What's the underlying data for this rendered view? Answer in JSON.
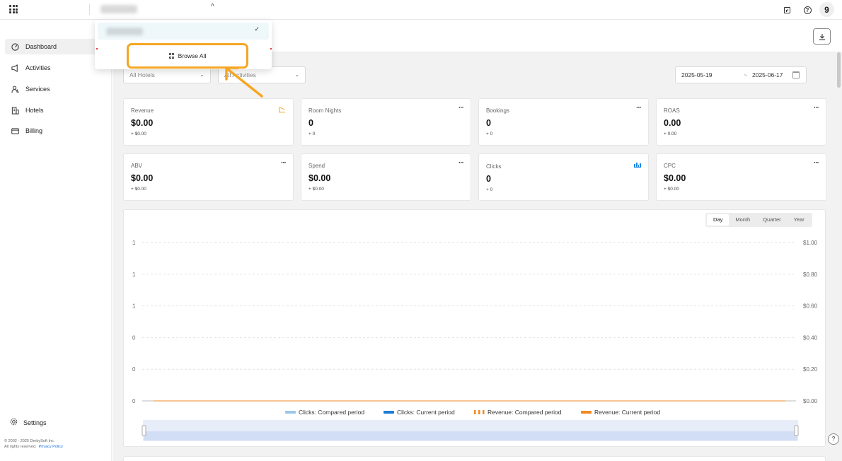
{
  "sidebar": {
    "items": [
      {
        "label": "Dashboard",
        "icon": "dashboard-icon",
        "active": true
      },
      {
        "label": "Activities",
        "icon": "megaphone-icon",
        "active": false
      },
      {
        "label": "Services",
        "icon": "services-icon",
        "active": false
      },
      {
        "label": "Hotels",
        "icon": "building-icon",
        "active": false
      },
      {
        "label": "Billing",
        "icon": "billing-icon",
        "active": false
      }
    ],
    "settings_label": "Settings",
    "copyright_line1": "© 2002 - 2025 DerbySoft Inc.",
    "copyright_line2": "All rights reserved.",
    "privacy_label": "Privacy Policy"
  },
  "topbar": {
    "caret": "^",
    "user_initial": "9"
  },
  "dropdown": {
    "check": "✓",
    "browse_all_label": "Browse All"
  },
  "filters": {
    "hotels": "All Hotels",
    "activities": "All Activities",
    "date_start": "2025-05-19",
    "date_sep": "~",
    "date_end": "2025-06-17"
  },
  "cards": [
    {
      "label": "Revenue",
      "value": "$0.00",
      "delta": "+ $0.00",
      "icon": "line-chart-icon"
    },
    {
      "label": "Room Nights",
      "value": "0",
      "delta": "+ 0",
      "icon": "more-icon"
    },
    {
      "label": "Bookings",
      "value": "0",
      "delta": "+ 0",
      "icon": "more-icon"
    },
    {
      "label": "ROAS",
      "value": "0.00",
      "delta": "+ 0.00",
      "icon": "more-icon"
    },
    {
      "label": "ABV",
      "value": "$0.00",
      "delta": "+ $0.00",
      "icon": "more-icon"
    },
    {
      "label": "Spend",
      "value": "$0.00",
      "delta": "+ $0.00",
      "icon": "more-icon"
    },
    {
      "label": "Clicks",
      "value": "0",
      "delta": "+ 0",
      "icon": "bar-chart-icon"
    },
    {
      "label": "CPC",
      "value": "$0.00",
      "delta": "+ $0.00",
      "icon": "more-icon"
    }
  ],
  "period_tabs": [
    {
      "label": "Day",
      "active": true
    },
    {
      "label": "Month",
      "active": false
    },
    {
      "label": "Quarter",
      "active": false
    },
    {
      "label": "Year",
      "active": false
    }
  ],
  "colors": {
    "accent_orange": "#f5a623",
    "clicks_compared": "#9cc7ea",
    "clicks_current": "#1e7bd8",
    "revenue_compared": "#f08a24",
    "revenue_current": "#f08a24"
  },
  "chart_data": {
    "type": "line",
    "y_left_ticks": [
      "1",
      "1",
      "1",
      "0",
      "0",
      "0"
    ],
    "y_right_ticks": [
      "$1.00",
      "$0.80",
      "$0.60",
      "$0.40",
      "$0.20",
      "$0.00"
    ],
    "ylim_right": [
      0,
      1
    ],
    "grid": true,
    "legend_position": "bottom",
    "series": [
      {
        "name": "Clicks: Compared period",
        "style": "bar-light",
        "values": [
          0
        ]
      },
      {
        "name": "Clicks: Current period",
        "style": "bar-solid",
        "values": [
          0
        ]
      },
      {
        "name": "Revenue: Compared period",
        "style": "dashed-line",
        "values": [
          0
        ]
      },
      {
        "name": "Revenue: Current period",
        "style": "line",
        "values": [
          0
        ]
      }
    ]
  }
}
